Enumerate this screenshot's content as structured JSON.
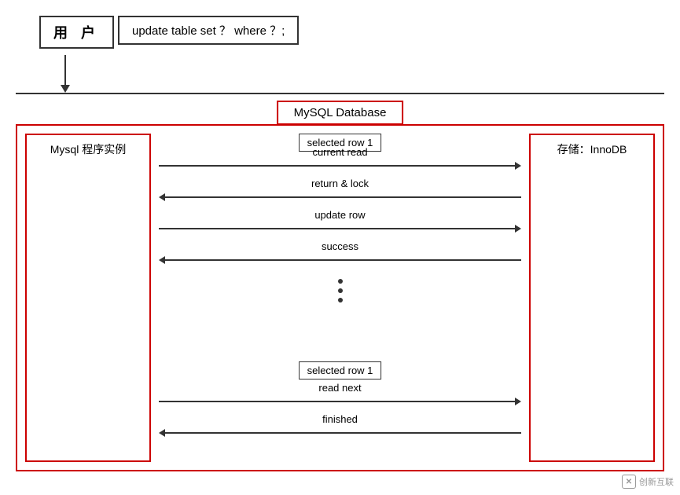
{
  "user_box": {
    "label": "用  户"
  },
  "sql_box": {
    "label": "update table set ？ where ？;"
  },
  "mysql_box": {
    "label": "MySQL   Database"
  },
  "left_box": {
    "label": "Mysql 程序实例"
  },
  "right_box": {
    "label": "存储：InnoDB"
  },
  "sequence": {
    "selected_row_top": "selected  row 1",
    "arrows": [
      {
        "direction": "right",
        "label": "current read"
      },
      {
        "direction": "left",
        "label": "return & lock"
      },
      {
        "direction": "right",
        "label": "update row"
      },
      {
        "direction": "left",
        "label": "success"
      }
    ],
    "selected_row_bottom": "selected  row 1",
    "arrows2": [
      {
        "direction": "right",
        "label": "read  next"
      },
      {
        "direction": "left",
        "label": "finished"
      }
    ]
  },
  "watermark": {
    "icon": "✕",
    "text": "创新互联"
  }
}
